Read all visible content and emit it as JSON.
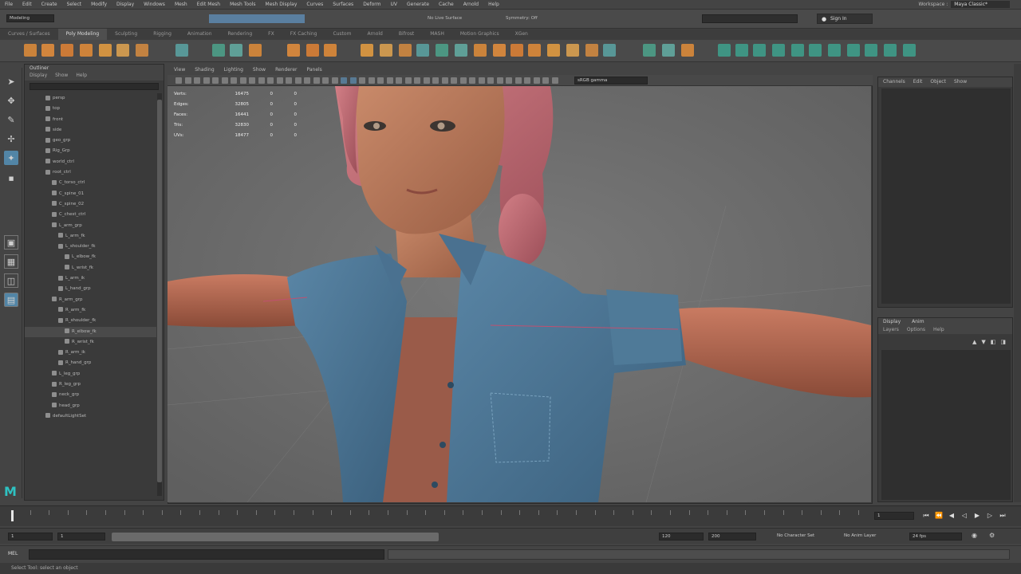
{
  "app": {
    "name": "Autodesk Maya"
  },
  "menubar": {
    "items": [
      "File",
      "Edit",
      "Create",
      "Select",
      "Modify",
      "Display",
      "Windows",
      "Mesh",
      "Edit Mesh",
      "Mesh Tools",
      "Mesh Display",
      "Curves",
      "Surfaces",
      "Deform",
      "UV",
      "Generate",
      "Cache",
      "Arnold",
      "Help"
    ],
    "workspace_label": "Workspace :",
    "workspace_value": "Maya Classic*"
  },
  "statusline": {
    "mode_value": "Modeling",
    "live_surface": "No Live Surface",
    "symmetry": "Symmetry: Off",
    "sign_in": "Sign In"
  },
  "shelf": {
    "tabs": [
      "Curves / Surfaces",
      "Poly Modeling",
      "Sculpting",
      "Rigging",
      "Animation",
      "Rendering",
      "FX",
      "FX Caching",
      "Custom",
      "Arnold",
      "Bifrost",
      "MASH",
      "Motion Graphics",
      "XGen"
    ],
    "active_tab": 1,
    "icon_colors": [
      "#d98a3a",
      "#e08c3c",
      "#d97f35",
      "#dd8a38",
      "#e09a40",
      "#d9a050",
      "#cf8840",
      "#5aa0a0",
      "#4d9e88",
      "#62a8a0"
    ]
  },
  "outliner": {
    "title": "Outliner",
    "menu": [
      "Display",
      "Show",
      "Help"
    ],
    "rows": [
      {
        "label": "persp",
        "depth": 1
      },
      {
        "label": "top",
        "depth": 1
      },
      {
        "label": "front",
        "depth": 1
      },
      {
        "label": "side",
        "depth": 1
      },
      {
        "label": "geo_grp",
        "depth": 1
      },
      {
        "label": "Rig_Grp",
        "depth": 1
      },
      {
        "label": "world_ctrl",
        "depth": 1
      },
      {
        "label": "root_ctrl",
        "depth": 1
      },
      {
        "label": "C_torso_ctrl",
        "depth": 2
      },
      {
        "label": "C_spine_01",
        "depth": 2
      },
      {
        "label": "C_spine_02",
        "depth": 2
      },
      {
        "label": "C_chest_ctrl",
        "depth": 2
      },
      {
        "label": "L_arm_grp",
        "depth": 2
      },
      {
        "label": "L_arm_fk",
        "depth": 3
      },
      {
        "label": "L_shoulder_fk",
        "depth": 3
      },
      {
        "label": "L_elbow_fk",
        "depth": 4
      },
      {
        "label": "L_wrist_fk",
        "depth": 4
      },
      {
        "label": "L_arm_ik",
        "depth": 3
      },
      {
        "label": "L_hand_grp",
        "depth": 3
      },
      {
        "label": "R_arm_grp",
        "depth": 2
      },
      {
        "label": "R_arm_fk",
        "depth": 3
      },
      {
        "label": "R_shoulder_fk",
        "depth": 3
      },
      {
        "label": "R_elbow_fk",
        "depth": 4
      },
      {
        "label": "R_wrist_fk",
        "depth": 4
      },
      {
        "label": "R_arm_ik",
        "depth": 3
      },
      {
        "label": "R_hand_grp",
        "depth": 3
      },
      {
        "label": "L_leg_grp",
        "depth": 2
      },
      {
        "label": "R_leg_grp",
        "depth": 2
      },
      {
        "label": "neck_grp",
        "depth": 2
      },
      {
        "label": "head_grp",
        "depth": 2
      },
      {
        "label": "defaultLightSet",
        "depth": 1
      }
    ],
    "selected_row": 22
  },
  "viewport": {
    "menu": [
      "View",
      "Shading",
      "Lighting",
      "Show",
      "Renderer",
      "Panels"
    ],
    "camera_value": "sRGB gamma",
    "hud": [
      {
        "label": "Verts:",
        "v": "16475",
        "s": "0",
        "c": "0"
      },
      {
        "label": "Edges:",
        "v": "32805",
        "s": "0",
        "c": "0"
      },
      {
        "label": "Faces:",
        "v": "16441",
        "s": "0",
        "c": "0"
      },
      {
        "label": "Tris:",
        "v": "32830",
        "s": "0",
        "c": "0"
      },
      {
        "label": "UVs:",
        "v": "18477",
        "s": "0",
        "c": "0"
      }
    ]
  },
  "channel_box": {
    "menu": [
      "Channels",
      "Edit",
      "Object",
      "Show"
    ]
  },
  "layer_editor": {
    "tabs": [
      "Display",
      "Anim"
    ],
    "menu": [
      "Layers",
      "Options",
      "Help"
    ]
  },
  "timeslider": {
    "current_frame": "1"
  },
  "range": {
    "start": "1",
    "start_inner": "1",
    "end_inner": "120",
    "end": "200",
    "character_set": "No Character Set",
    "anim_layer": "No Anim Layer",
    "fps": "24 fps"
  },
  "cmdline": {
    "language": "MEL"
  },
  "helpline": {
    "text": "Select Tool: select an object"
  }
}
